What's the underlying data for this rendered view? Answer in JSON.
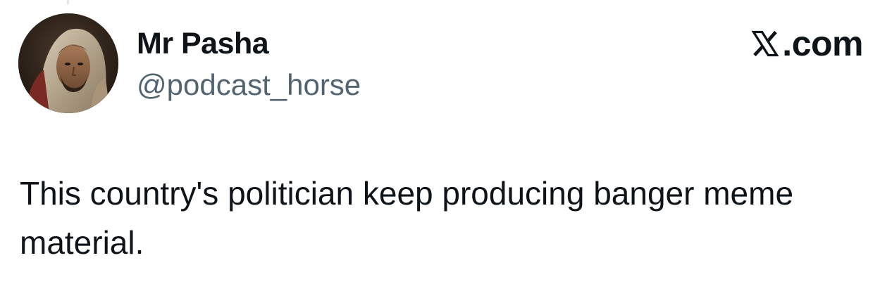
{
  "tweet": {
    "author": {
      "display_name": "Mr Pasha",
      "handle": "@podcast_horse",
      "avatar_icon": "avatar-portrait"
    },
    "brand": {
      "logo_icon": "x-logo-icon",
      "text": ".com"
    },
    "text": "This country's politician keep producing banger meme material."
  },
  "colors": {
    "text_primary": "#0f1419",
    "text_secondary": "#536471",
    "background": "#ffffff"
  }
}
